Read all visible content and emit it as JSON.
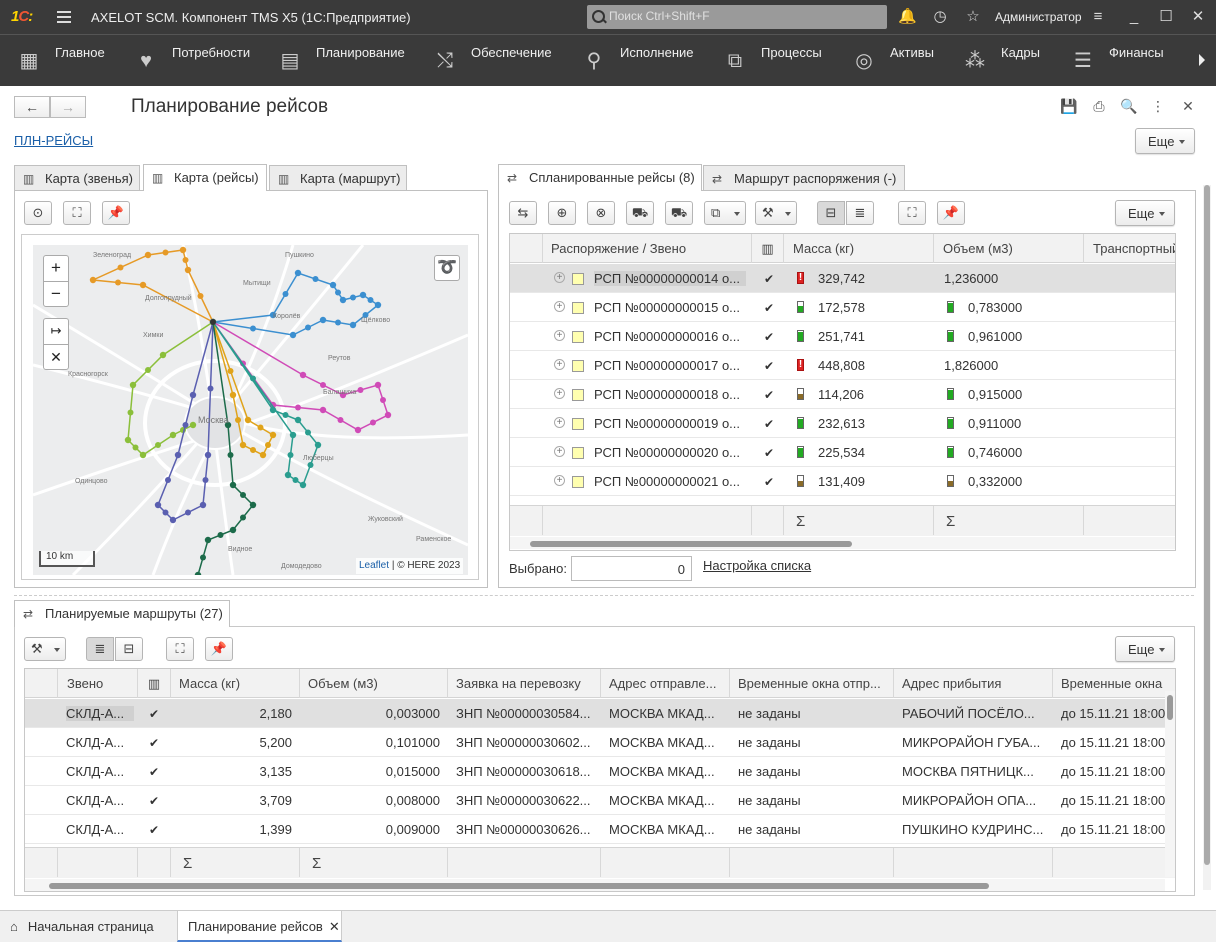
{
  "app": {
    "title": "AXELOT SCM. Компонент TMS X5  (1С:Предприятие)",
    "search_placeholder": "Поиск Ctrl+Shift+F",
    "user": "Администратор"
  },
  "sections": [
    {
      "label": "Главное",
      "icon": "grid-icon"
    },
    {
      "label": "Потребности",
      "icon": "heart-hand-icon"
    },
    {
      "label": "Планирование",
      "icon": "calendar-icon"
    },
    {
      "label": "Обеспечение",
      "icon": "handshake-icon"
    },
    {
      "label": "Исполнение",
      "icon": "route-icon"
    },
    {
      "label": "Процессы",
      "icon": "flow-icon"
    },
    {
      "label": "Активы",
      "icon": "ring-icon"
    },
    {
      "label": "Кадры",
      "icon": "people-icon"
    },
    {
      "label": "Финансы",
      "icon": "coins-icon"
    }
  ],
  "page": {
    "title": "Планирование рейсов",
    "link": "ПЛН-РЕЙСЫ",
    "more": "Еще"
  },
  "left_tabs": [
    "Карта (звенья)",
    "Карта (рейсы)",
    "Карта (маршрут)"
  ],
  "map": {
    "attribution_link": "Leaflet",
    "attribution_text": "| © HERE 2023",
    "scale": "10 km",
    "zoom_in": "+",
    "zoom_out": "−",
    "places": [
      "Пушкино",
      "Долгопрудный",
      "Химки",
      "Красногорск",
      "Королёв",
      "Щёлково",
      "Балашиха",
      "Москва",
      "Люберцы",
      "Одинцово",
      "Видное",
      "Жуковский",
      "Раменское",
      "Домодедово",
      "Реутов",
      "Мытищи",
      "Зеленоград"
    ]
  },
  "right_tabs": [
    "Спланированные рейсы (8)",
    "Маршрут распоряжения (-)"
  ],
  "trips": {
    "more": "Еще",
    "columns": [
      "Распоряжение / Звено",
      "",
      "Масса (кг)",
      "Объем (м3)",
      "Транспортный"
    ],
    "rows": [
      {
        "order": "РСП №00000000014 о...",
        "mass": "329,742",
        "mass_ind": "r",
        "volume": "1,236000",
        "vol_ind": "",
        "selected": true
      },
      {
        "order": "РСП №00000000015 о...",
        "mass": "172,578",
        "mass_ind": "yy",
        "volume": "0,783000",
        "vol_ind": "g",
        "selected": false
      },
      {
        "order": "РСП №00000000016 о...",
        "mass": "251,741",
        "mass_ind": "g",
        "volume": "0,961000",
        "vol_ind": "g",
        "selected": false
      },
      {
        "order": "РСП №00000000017 о...",
        "mass": "448,808",
        "mass_ind": "r",
        "volume": "1,826000",
        "vol_ind": "",
        "selected": false
      },
      {
        "order": "РСП №00000000018 о...",
        "mass": "114,206",
        "mass_ind": "y",
        "volume": "0,915000",
        "vol_ind": "g",
        "selected": false
      },
      {
        "order": "РСП №00000000019 о...",
        "mass": "232,613",
        "mass_ind": "g",
        "volume": "0,911000",
        "vol_ind": "g",
        "selected": false
      },
      {
        "order": "РСП №00000000020 о...",
        "mass": "225,534",
        "mass_ind": "g",
        "volume": "0,746000",
        "vol_ind": "g",
        "selected": false
      },
      {
        "order": "РСП №00000000021 о...",
        "mass": "131,409",
        "mass_ind": "y",
        "volume": "0,332000",
        "vol_ind": "y",
        "selected": false
      }
    ],
    "sigma": "Σ",
    "selected_label": "Выбрано:",
    "selected_value": "0",
    "settings_link": "Настройка списка"
  },
  "routes": {
    "tab": "Планируемые маршруты (27)",
    "more": "Еще",
    "columns": [
      "Звено",
      "",
      "Масса (кг)",
      "Объем (м3)",
      "Заявка на перевозку",
      "Адрес отправле...",
      "Временные окна отпр...",
      "Адрес прибытия",
      "Временные окна"
    ],
    "rows": [
      {
        "link": "СКЛД-А...",
        "mass": "2,180",
        "volume": "0,003000",
        "request": "ЗНП №00000030584...",
        "from": "МОСКВА МКАД...",
        "window_from": "не заданы",
        "to": "РАБОЧИЙ ПОСЁЛО...",
        "window_to": "до 15.11.21 18:00",
        "selected": true
      },
      {
        "link": "СКЛД-А...",
        "mass": "5,200",
        "volume": "0,101000",
        "request": "ЗНП №00000030602...",
        "from": "МОСКВА МКАД...",
        "window_from": "не заданы",
        "to": "МИКРОРАЙОН ГУБА...",
        "window_to": "до 15.11.21 18:00",
        "selected": false
      },
      {
        "link": "СКЛД-А...",
        "mass": "3,135",
        "volume": "0,015000",
        "request": "ЗНП №00000030618...",
        "from": "МОСКВА МКАД...",
        "window_from": "не заданы",
        "to": "МОСКВА ПЯТНИЦК...",
        "window_to": "до 15.11.21 18:00",
        "selected": false
      },
      {
        "link": "СКЛД-А...",
        "mass": "3,709",
        "volume": "0,008000",
        "request": "ЗНП №00000030622...",
        "from": "МОСКВА МКАД...",
        "window_from": "не заданы",
        "to": "МИКРОРАЙОН ОПА...",
        "window_to": "до 15.11.21 18:00",
        "selected": false
      },
      {
        "link": "СКЛД-А...",
        "mass": "1,399",
        "volume": "0,009000",
        "request": "ЗНП №00000030626...",
        "from": "МОСКВА МКАД...",
        "window_from": "не заданы",
        "to": "ПУШКИНО КУДРИНС...",
        "window_to": "до 15.11.21 18:00",
        "selected": false
      }
    ],
    "sigma": "Σ"
  },
  "bottom_tabs": [
    "Начальная страница",
    "Планирование рейсов"
  ],
  "colors": {
    "bar": "#3a3a3a",
    "link": "#1a5fa8",
    "route_colors": [
      "#e69a26",
      "#3b8fd0",
      "#d04bb7",
      "#8bbf3a",
      "#5a5fb0",
      "#e0a31a",
      "#2a9d8f",
      "#1c6b4a"
    ]
  }
}
